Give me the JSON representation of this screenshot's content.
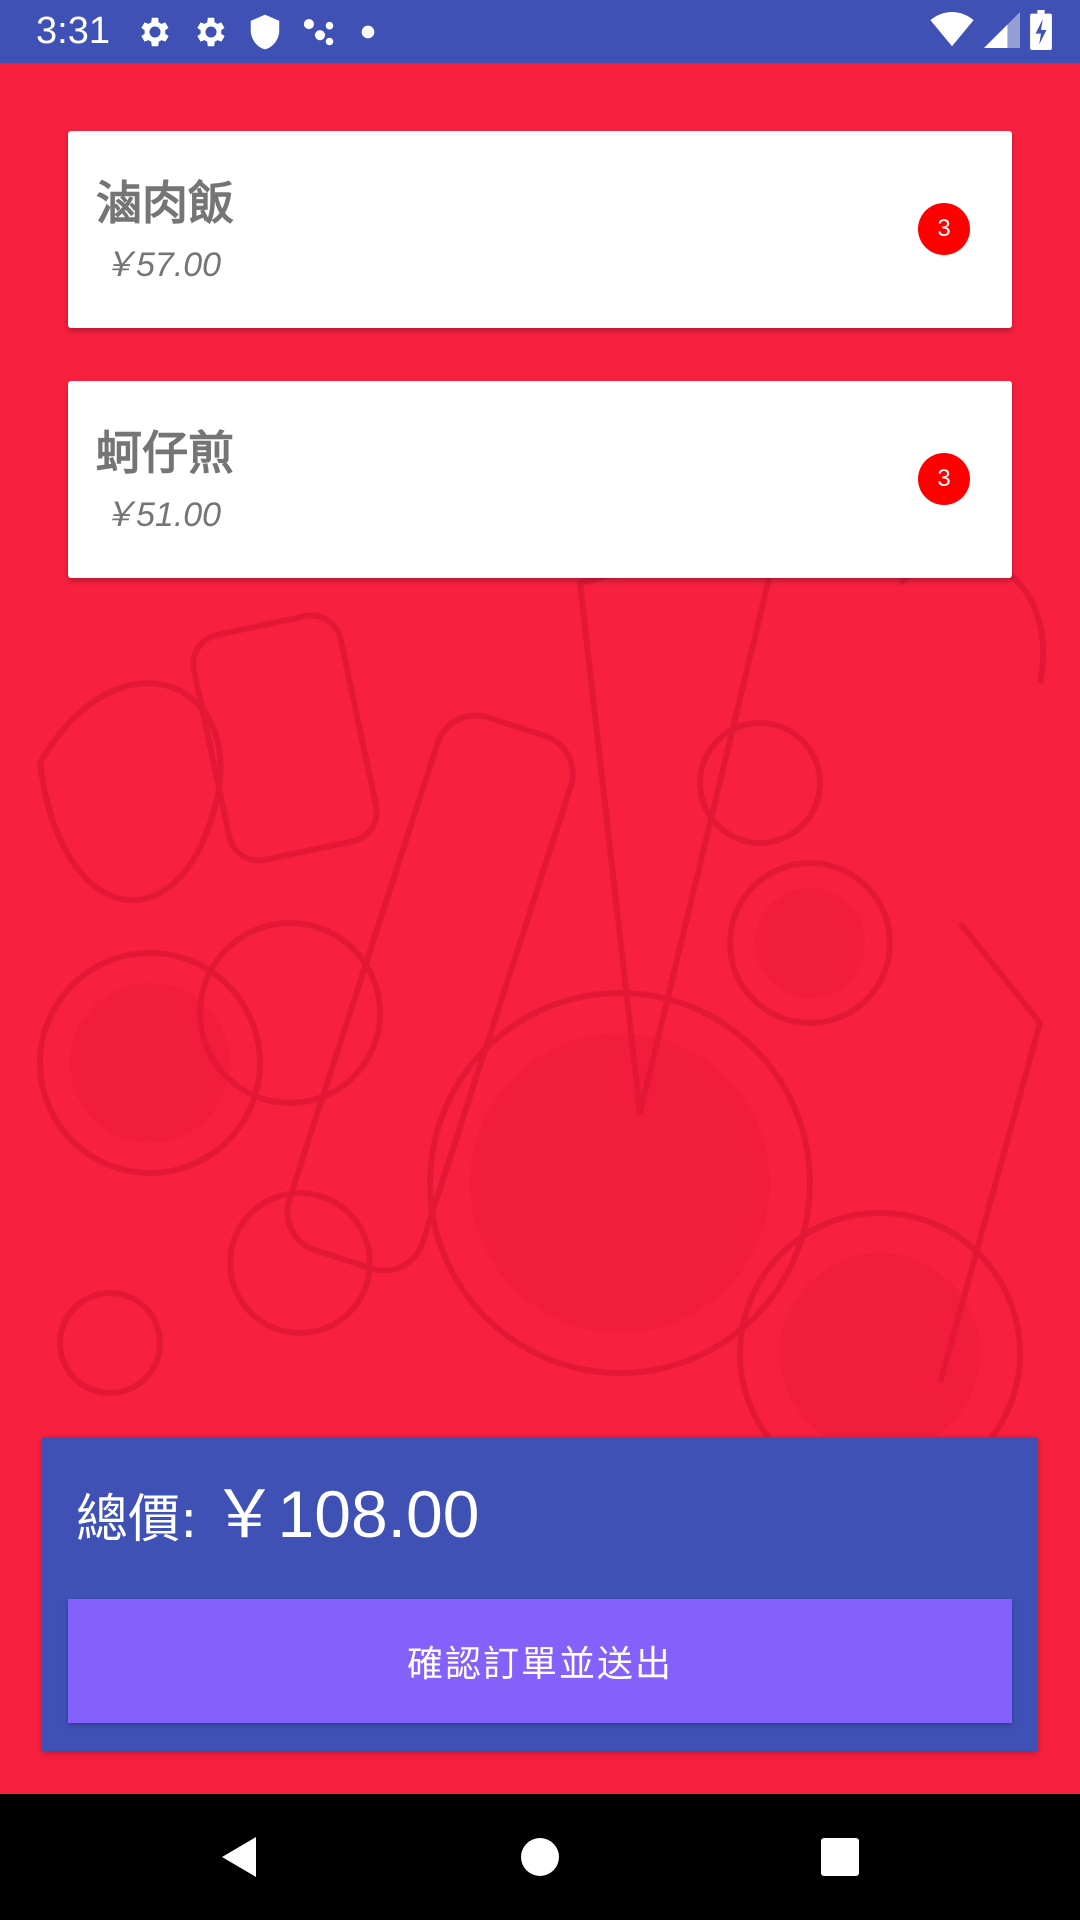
{
  "status_bar": {
    "time": "3:31",
    "left_icons": [
      "gear-icon",
      "gear-icon",
      "shield-icon",
      "dots-icon",
      "dot-icon"
    ],
    "right_icons": [
      "wifi-icon",
      "signal-icon",
      "battery-icon"
    ]
  },
  "order": {
    "items": [
      {
        "name": "滷肉飯",
        "price": "￥57.00",
        "quantity": "3"
      },
      {
        "name": "蚵仔煎",
        "price": "￥51.00",
        "quantity": "3"
      }
    ]
  },
  "summary": {
    "total_label": "總價:",
    "total_value": "￥108.00",
    "submit_label": "確認訂單並送出"
  },
  "nav_bar": {
    "buttons": [
      "back-icon",
      "home-icon",
      "recents-icon"
    ]
  },
  "colors": {
    "primary": "#3f51b5",
    "background": "#f7203f",
    "badge": "#ff0000",
    "button": "#8561fc"
  }
}
